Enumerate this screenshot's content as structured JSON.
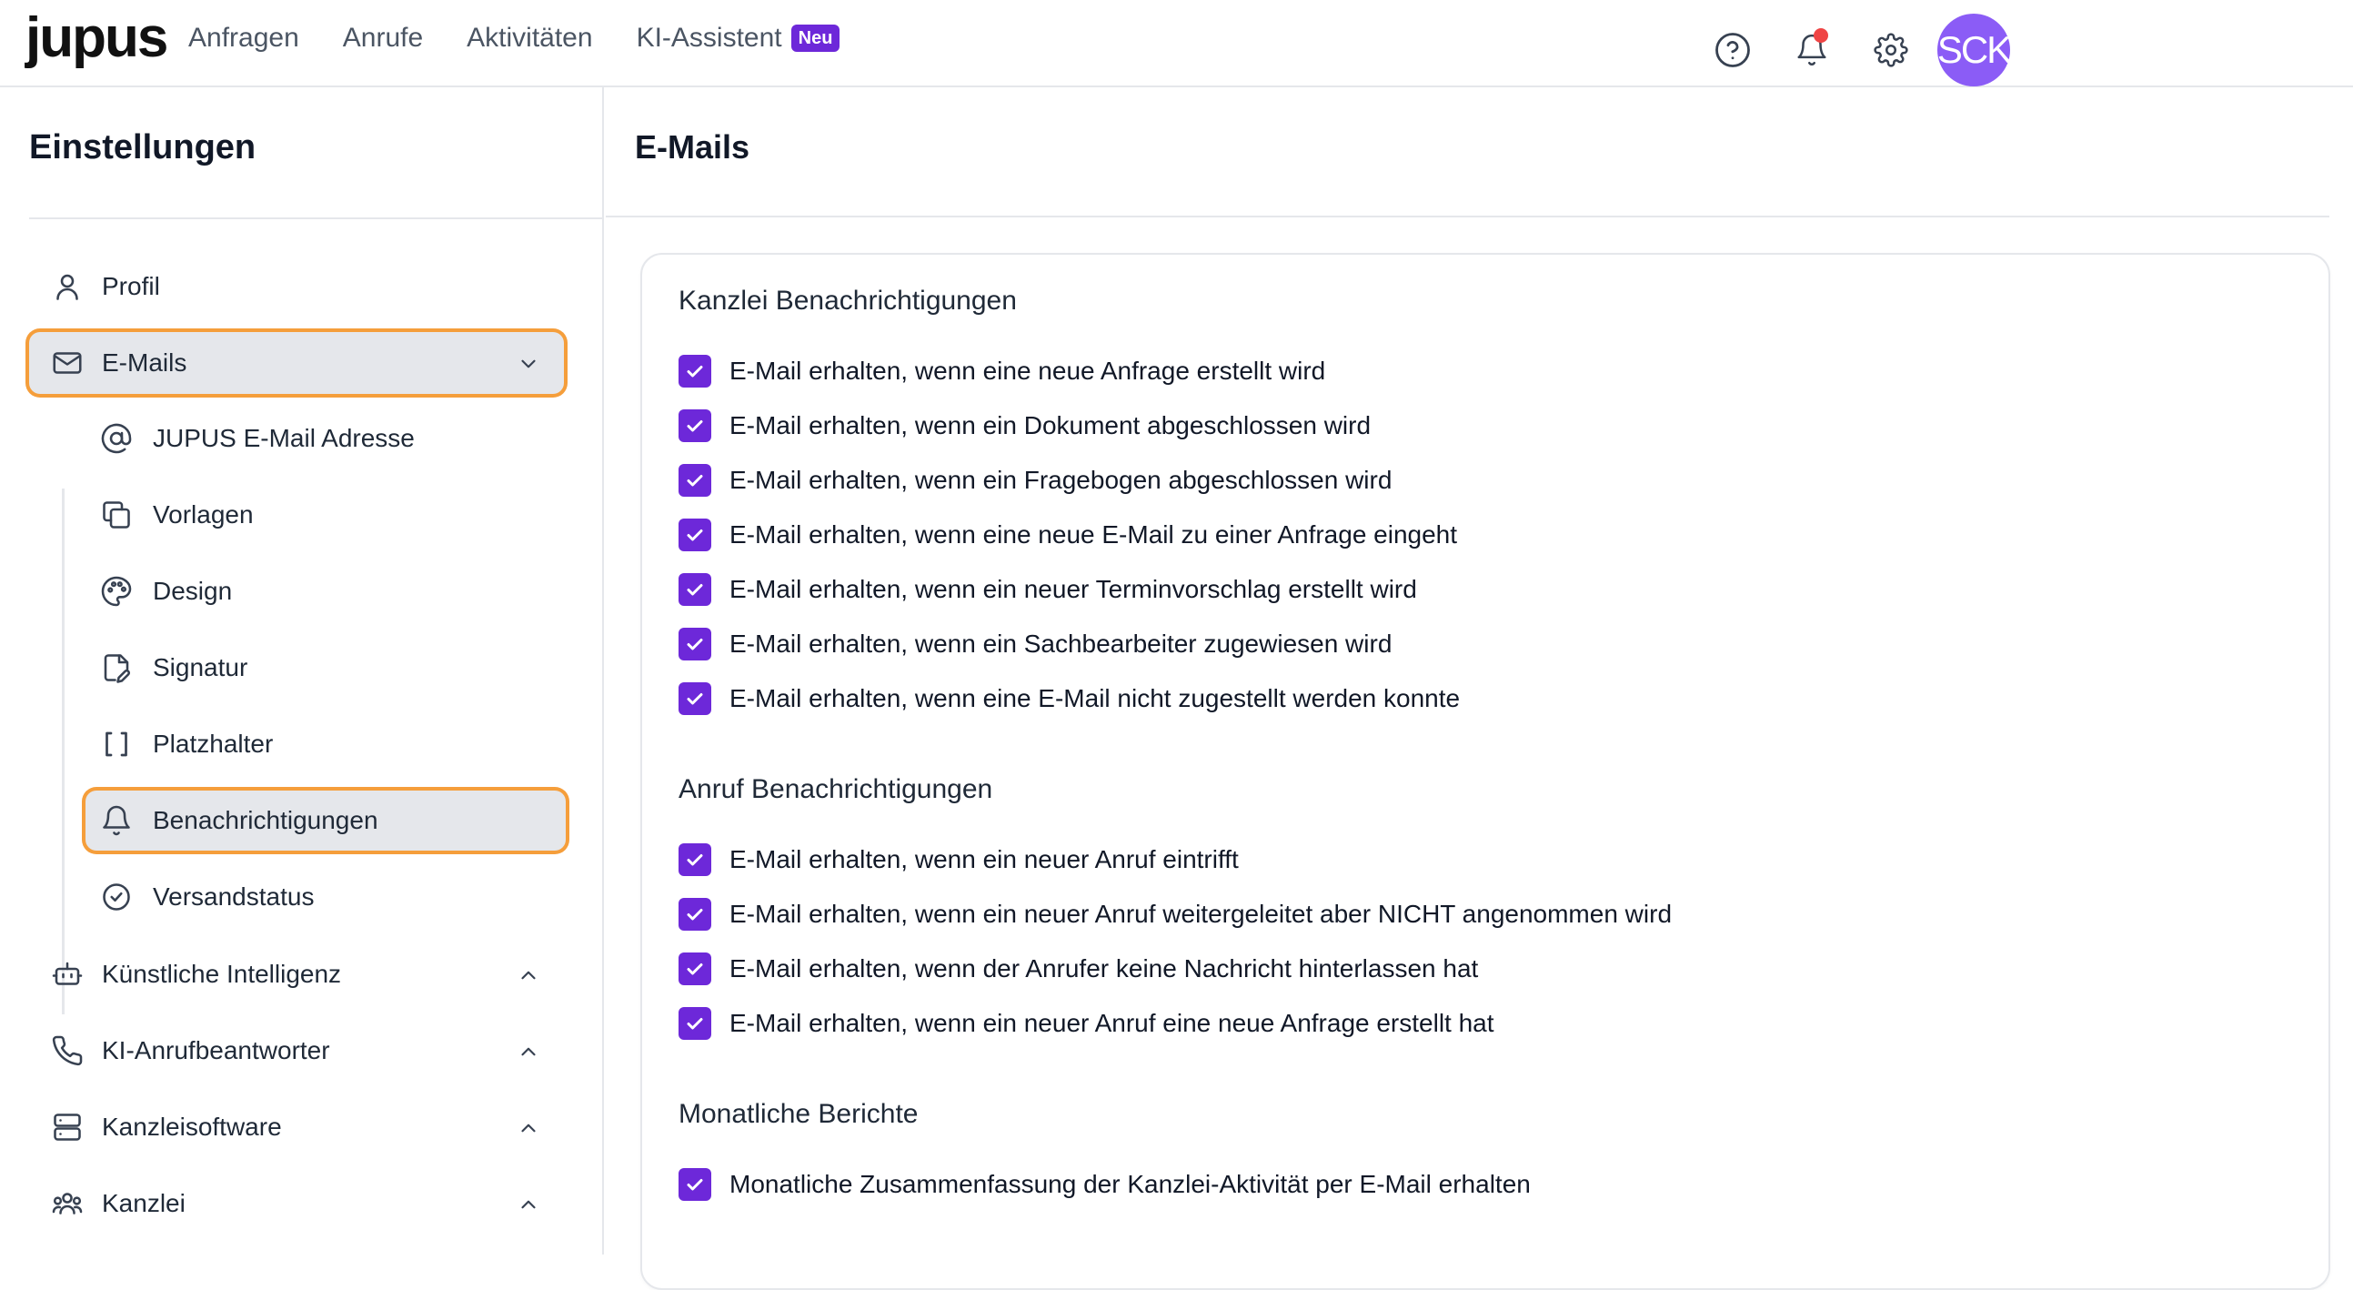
{
  "header": {
    "logo": "jupus",
    "nav": [
      {
        "label": "Anfragen"
      },
      {
        "label": "Anrufe"
      },
      {
        "label": "Aktivitäten"
      },
      {
        "label": "KI-Assistent",
        "badge": "Neu"
      }
    ],
    "avatar_initials": "SCK",
    "icons": [
      "help-circle-icon",
      "bell-icon",
      "gear-icon"
    ],
    "colors": {
      "accent": "#6d28d9",
      "badge": "#6d28d9",
      "avatar": "#8b5cf6",
      "notification_dot": "#ef4444",
      "highlight": "#f59e3b"
    }
  },
  "sidebar": {
    "title": "Einstellungen",
    "items": [
      {
        "label": "Profil",
        "icon": "user-icon"
      },
      {
        "label": "E-Mails",
        "icon": "mail-icon",
        "expanded": true,
        "active": true
      },
      {
        "label": "Künstliche Intelligenz",
        "icon": "bot-icon"
      },
      {
        "label": "KI-Anrufbeantworter",
        "icon": "phone-icon"
      },
      {
        "label": "Kanzleisoftware",
        "icon": "server-icon"
      },
      {
        "label": "Kanzlei",
        "icon": "users-icon"
      }
    ],
    "subitems": [
      {
        "label": "JUPUS E-Mail Adresse",
        "icon": "at-icon"
      },
      {
        "label": "Vorlagen",
        "icon": "copy-icon"
      },
      {
        "label": "Design",
        "icon": "palette-icon"
      },
      {
        "label": "Signatur",
        "icon": "file-signature-icon"
      },
      {
        "label": "Platzhalter",
        "icon": "brackets-icon"
      },
      {
        "label": "Benachrichtigungen",
        "icon": "bell-icon",
        "active": true
      },
      {
        "label": "Versandstatus",
        "icon": "check-circle-icon"
      }
    ]
  },
  "main": {
    "title": "E-Mails",
    "sections": [
      {
        "title": "Kanzlei Benachrichtigungen",
        "options": [
          {
            "label": "E-Mail erhalten, wenn eine neue Anfrage erstellt wird",
            "checked": true
          },
          {
            "label": "E-Mail erhalten, wenn ein Dokument abgeschlossen wird",
            "checked": true
          },
          {
            "label": "E-Mail erhalten, wenn ein Fragebogen abgeschlossen wird",
            "checked": true
          },
          {
            "label": "E-Mail erhalten, wenn eine neue E-Mail zu einer Anfrage eingeht",
            "checked": true
          },
          {
            "label": "E-Mail erhalten, wenn ein neuer Terminvorschlag erstellt wird",
            "checked": true
          },
          {
            "label": "E-Mail erhalten, wenn ein Sachbearbeiter zugewiesen wird",
            "checked": true
          },
          {
            "label": "E-Mail erhalten, wenn eine E-Mail nicht zugestellt werden konnte",
            "checked": true
          }
        ]
      },
      {
        "title": "Anruf Benachrichtigungen",
        "options": [
          {
            "label": "E-Mail erhalten, wenn ein neuer Anruf eintrifft",
            "checked": true
          },
          {
            "label": "E-Mail erhalten, wenn ein neuer Anruf weitergeleitet aber NICHT angenommen wird",
            "checked": true
          },
          {
            "label": "E-Mail erhalten, wenn der Anrufer keine Nachricht hinterlassen hat",
            "checked": true
          },
          {
            "label": "E-Mail erhalten, wenn ein neuer Anruf eine neue Anfrage erstellt hat",
            "checked": true
          }
        ]
      },
      {
        "title": "Monatliche Berichte",
        "options": [
          {
            "label": "Monatliche Zusammenfassung der Kanzlei-Aktivität per E-Mail erhalten",
            "checked": true
          }
        ]
      }
    ]
  }
}
